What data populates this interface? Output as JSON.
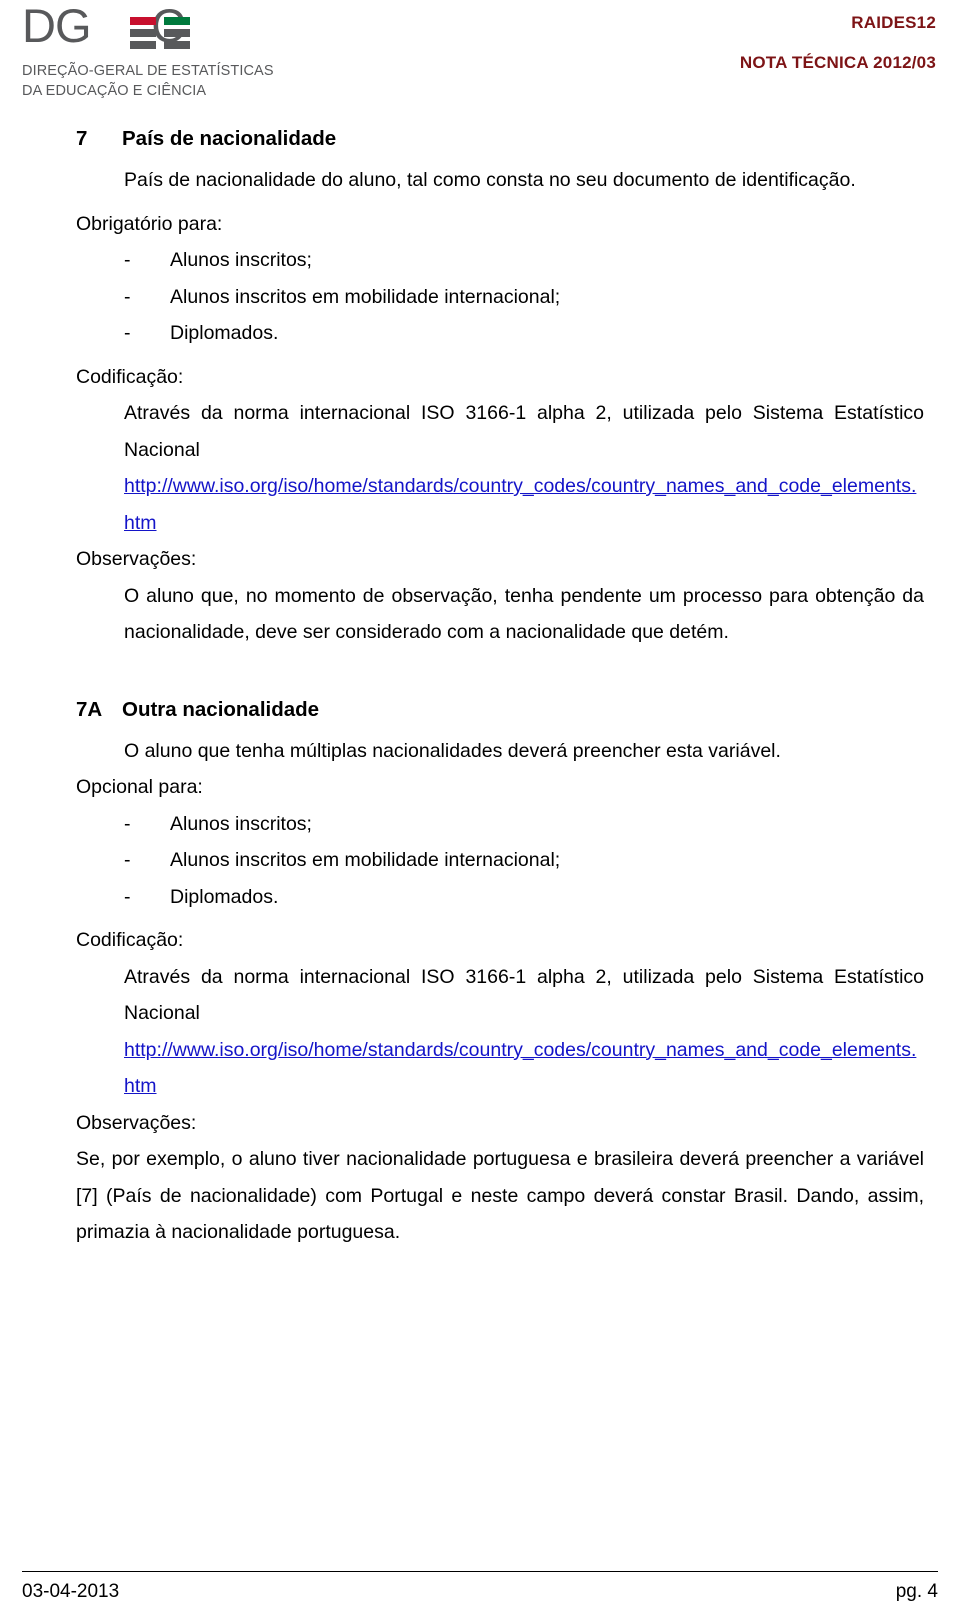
{
  "header": {
    "logo": {
      "wordmark": "DGEEC",
      "wordmark_pre": "DG",
      "wordmark_post": "C",
      "subtitle_line1": "DIREÇÃO-GERAL DE ESTATÍSTICAS",
      "subtitle_line2": "DA EDUCAÇÃO E CIÊNCIA",
      "accent_red": "#c8102e",
      "accent_green": "#007a3d",
      "gray": "#58595b"
    },
    "doc_code": "RAIDES12",
    "doc_title": "NOTA TÉCNICA 2012/03",
    "doc_color": "#7d1416"
  },
  "sections": [
    {
      "number": "7",
      "title": "País de nacionalidade",
      "intro": "País de nacionalidade do aluno, tal como consta no seu documento de identificação.",
      "requirement_label": "Obrigatório para:",
      "requirement_items": [
        "Alunos inscritos;",
        "Alunos inscritos em mobilidade internacional;",
        "Diplomados."
      ],
      "coding_label": "Codificação:",
      "coding_text": "Através da norma internacional ISO 3166-1 alpha 2, utilizada pelo Sistema Estatístico Nacional",
      "coding_url": "http://www.iso.org/iso/home/standards/country_codes/country_names_and_code_elements.htm",
      "notes_label": "Observações:",
      "notes_text": "O aluno que, no momento de observação, tenha pendente um processo para obtenção da nacionalidade, deve ser considerado com a nacionalidade que detém."
    },
    {
      "number": "7A",
      "title": "Outra nacionalidade",
      "intro": "O aluno que tenha múltiplas nacionalidades deverá preencher esta variável.",
      "requirement_label": "Opcional para:",
      "requirement_items": [
        "Alunos inscritos;",
        "Alunos inscritos em mobilidade internacional;",
        "Diplomados."
      ],
      "coding_label": "Codificação:",
      "coding_text": "Através da norma internacional ISO 3166-1 alpha 2, utilizada pelo Sistema Estatístico Nacional",
      "coding_url": "http://www.iso.org/iso/home/standards/country_codes/country_names_and_code_elements.htm",
      "notes_label": "Observações:",
      "notes_text": "Se, por exemplo, o aluno tiver nacionalidade portuguesa e brasileira deverá preencher a variável [7] (País de nacionalidade) com Portugal e neste campo deverá constar Brasil. Dando, assim, primazia à nacionalidade portuguesa."
    }
  ],
  "list_dash": "-",
  "footer": {
    "date": "03-04-2013",
    "page": "pg. 4"
  }
}
